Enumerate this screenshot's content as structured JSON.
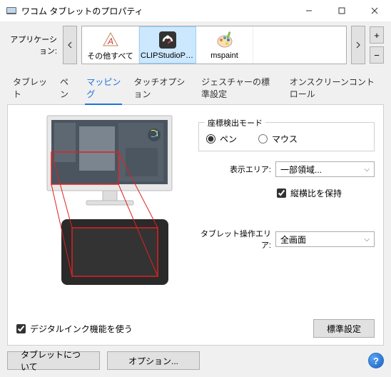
{
  "window": {
    "title": "ワコム タブレットのプロパティ"
  },
  "appRow": {
    "label": "アプリケーション:",
    "items": [
      {
        "label": "その他すべて"
      },
      {
        "label": "CLIPStudioPai..."
      },
      {
        "label": "mspaint"
      }
    ]
  },
  "tabs": {
    "tablet": "タブレット",
    "pen": "ペン",
    "mapping": "マッピング",
    "touch": "タッチオプション",
    "gesture": "ジェスチャーの標準設定",
    "onscreen": "オンスクリーンコントロール"
  },
  "mapping": {
    "modeGroup": "座標検出モード",
    "modePen": "ペン",
    "modeMouse": "マウス",
    "displayAreaLabel": "表示エリア:",
    "displayAreaValue": "一部領域...",
    "keepAspect": "縦横比を保持",
    "tabletAreaLabel": "タブレット操作エリア:",
    "tabletAreaValue": "全画面",
    "digitalInk": "デジタルインク機能を使う",
    "defaults": "標準設定"
  },
  "footer": {
    "about": "タブレットについて",
    "options": "オプション..."
  }
}
